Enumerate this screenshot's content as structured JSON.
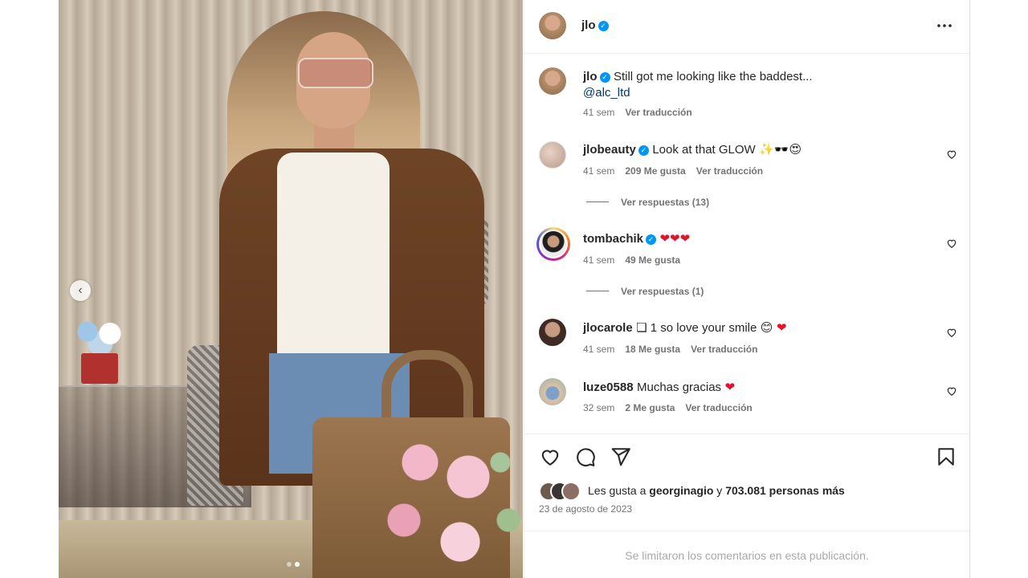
{
  "post": {
    "author": "jlo",
    "date": "23 de agosto de 2023",
    "more_icon": "more-horizontal-icon"
  },
  "caption": {
    "username": "jlo",
    "text": "Still got me looking like the baddest...",
    "mention": "@alc_ltd",
    "time": "41 sem",
    "translate": "Ver traducción"
  },
  "comments": [
    {
      "username": "jlobeauty",
      "verified": true,
      "text": "Look at that GLOW",
      "emoji": "✨🕶️😍",
      "time": "41 sem",
      "likes": "209 Me gusta",
      "translate": "Ver traducción",
      "replies": "Ver respuestas (13)"
    },
    {
      "username": "tombachik",
      "verified": true,
      "text": "",
      "emoji": "❤❤❤",
      "time": "41 sem",
      "likes": "49 Me gusta",
      "replies": "Ver respuestas (1)"
    },
    {
      "username": "jlocarole",
      "verified": false,
      "text": "❏ 1 so love your smile",
      "emoji": "😊",
      "emoji2": "❤",
      "time": "41 sem",
      "likes": "18 Me gusta",
      "translate": "Ver traducción"
    },
    {
      "username": "luze0588",
      "verified": false,
      "text": "Muchas gracias",
      "emoji": "❤",
      "time": "32 sem",
      "likes": "2 Me gusta",
      "translate": "Ver traducción"
    }
  ],
  "actions": {
    "like_icon": "heart-icon",
    "comment_icon": "comment-icon",
    "share_icon": "send-icon",
    "save_icon": "bookmark-icon"
  },
  "likes": {
    "prefix": "Les gusta a",
    "user": "georginagio",
    "connector": "y",
    "count": "703.081 personas más"
  },
  "footer": {
    "limited": "Se limitaron los comentarios en esta publicación."
  },
  "colors": {
    "verified": "#0095f6",
    "link": "#00376b",
    "secondary": "#737373",
    "heart": "#e0142b"
  }
}
